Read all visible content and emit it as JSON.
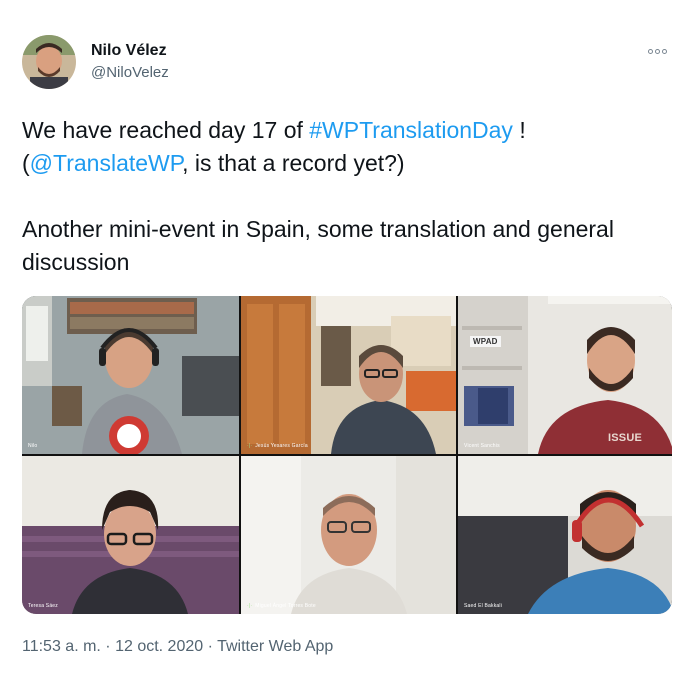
{
  "author": {
    "name": "Nilo Vélez",
    "handle": "@NiloVelez"
  },
  "more_icon": "more-options-icon",
  "tweet": {
    "line1_prefix": "We have reached day 17 of ",
    "hashtag": "#WPTranslationDay",
    "line1_suffix": " !",
    "paren_open": "(",
    "mention": "@TranslateWP",
    "line2_suffix": ", is that a record yet?)",
    "paragraph2": "Another mini-event in Spain, some translation and general discussion"
  },
  "video_call": {
    "participants": [
      {
        "label": "Nilo"
      },
      {
        "label": "Jesús Yesares García"
      },
      {
        "label": "Vicent Sanchis"
      },
      {
        "label": "Teresa Sáez"
      },
      {
        "label": "Miguel Ángel Torres Bote"
      },
      {
        "label": "Saed El Bakkali"
      }
    ],
    "shelf_sign": "WPAD",
    "shirt_text": "ISSUE"
  },
  "meta": {
    "time": "11:53 a. m.",
    "separator": " · ",
    "date": "12 oct. 2020",
    "source": "Twitter Web App"
  },
  "colors": {
    "link": "#1d9bf0",
    "meta": "#536471",
    "text": "#0f1419"
  }
}
